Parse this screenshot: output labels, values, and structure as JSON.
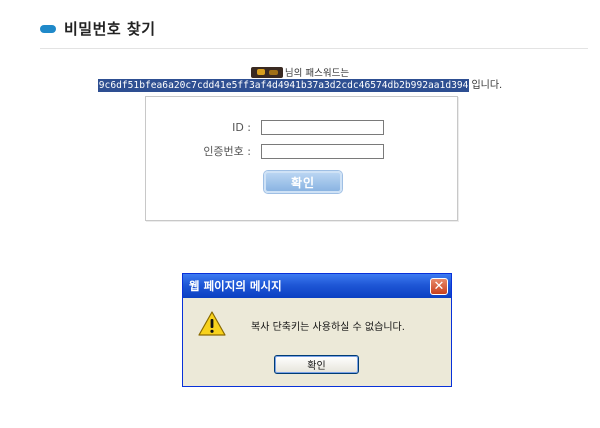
{
  "header": {
    "title": "비밀번호 찾기",
    "accent_color": "#1f89c9"
  },
  "result": {
    "line1_suffix": "님의 패스워드는",
    "hash": "9c6df51bfea6a20c7cdd41e5ff3af4d4941b37a3d2cdc46574db2b992aa1d394",
    "line2_suffix": "입니다."
  },
  "form": {
    "id_label": "ID :",
    "code_label": "인증번호 :",
    "id_value": "",
    "code_value": "",
    "submit_label": "확인"
  },
  "dialog": {
    "title": "웹 페이지의 메시지",
    "close_glyph": "✕",
    "message": "복사 단축키는 사용하실 수 없습니다.",
    "ok_label": "확인",
    "icon": "warning-icon"
  }
}
